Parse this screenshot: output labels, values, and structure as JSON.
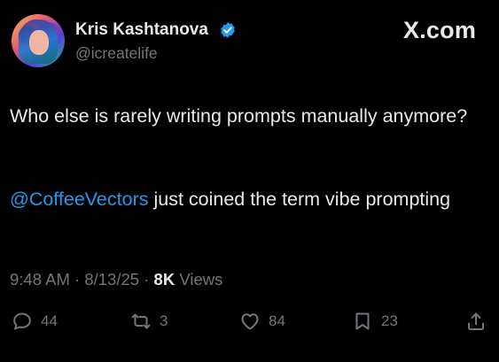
{
  "author": {
    "name": "Kris Kashtanova",
    "handle": "@icreatelife",
    "verified_badge_color": "#1d9bf0"
  },
  "site_logo": "X.com",
  "tweet": {
    "line1": "Who else is rarely writing prompts manually anymore?",
    "mention": "@CoffeeVectors",
    "line2_rest": " just coined the term vibe prompting"
  },
  "meta": {
    "time": "9:48 AM",
    "date": "8/13/25",
    "separator": " · ",
    "views_count": "8K",
    "views_label": " Views"
  },
  "actions": {
    "replies": "44",
    "retweets": "3",
    "likes": "84",
    "bookmarks": "23"
  },
  "icons": [
    "reply-icon",
    "retweet-icon",
    "like-icon",
    "bookmark-icon",
    "share-icon",
    "verified-icon"
  ],
  "colors": {
    "background": "#000000",
    "text": "#e7e9ea",
    "secondary": "#71767b",
    "accent": "#1d9bf0"
  }
}
